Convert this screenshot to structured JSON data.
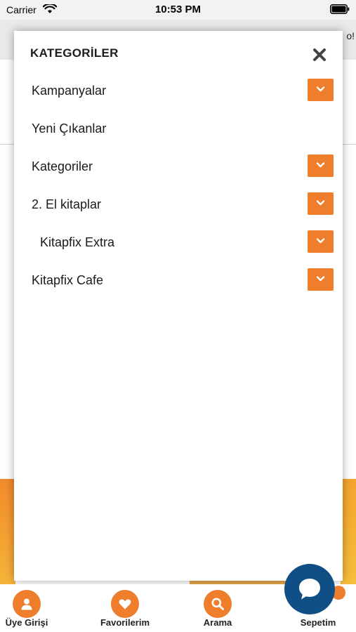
{
  "status_bar": {
    "carrier": "Carrier",
    "time": "10:53 PM"
  },
  "background": {
    "header_text_fragment": "o!"
  },
  "menu": {
    "title": "KATEGORİLER",
    "items": [
      {
        "label": "Kampanyalar",
        "has_submenu": true
      },
      {
        "label": "Yeni Çıkanlar",
        "has_submenu": false
      },
      {
        "label": "Kategoriler",
        "has_submenu": true
      },
      {
        "label": "2. El kitaplar",
        "has_submenu": true
      },
      {
        "label": "Kitapfix Extra",
        "has_submenu": true,
        "indented": true
      },
      {
        "label": "Kitapfix Cafe",
        "has_submenu": true
      }
    ]
  },
  "tab_bar": {
    "tabs": [
      {
        "label": "Üye Girişi",
        "icon": "user-icon"
      },
      {
        "label": "Favorilerim",
        "icon": "heart-icon"
      },
      {
        "label": "Arama",
        "icon": "search-icon"
      },
      {
        "label": "Sepetim",
        "icon": "cart-icon"
      }
    ]
  },
  "colors": {
    "accent": "#ee7d2c",
    "chat": "#0f4f86",
    "text": "#1a1a1a"
  }
}
